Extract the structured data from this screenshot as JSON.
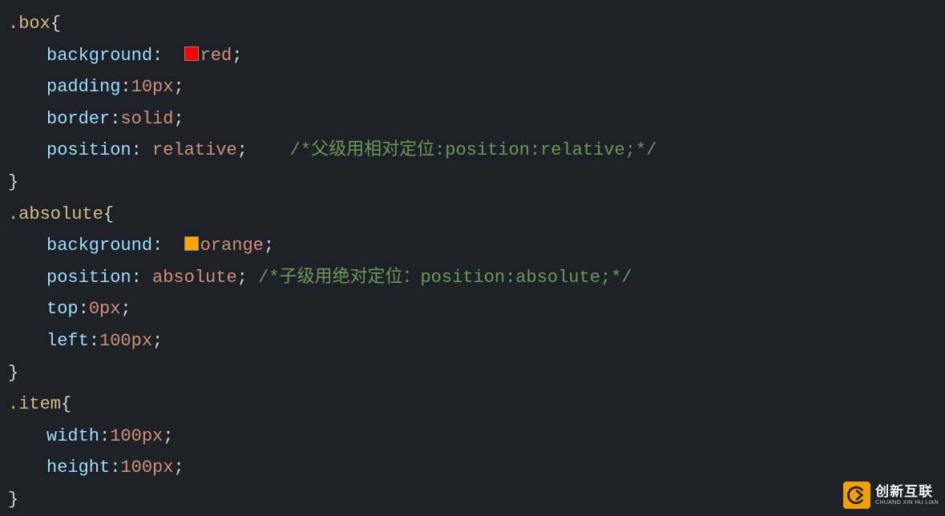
{
  "code": {
    "rule1": {
      "selector": ".box",
      "open_brace": "{",
      "close_brace": "}",
      "props": {
        "p1_name": "background",
        "p1_value": "red",
        "p1_swatch_color": "red",
        "p2_name": "padding",
        "p2_value": "10px",
        "p3_name": "border",
        "p3_value": "solid",
        "p4_name": "position",
        "p4_value": "relative",
        "p4_comment": "/*父级用相对定位:position:relative;*/"
      }
    },
    "rule2": {
      "selector": ".absolute",
      "open_brace": "{",
      "close_brace": "}",
      "props": {
        "p1_name": "background",
        "p1_value": "orange",
        "p1_swatch_color": "orange",
        "p2_name": "position",
        "p2_value": "absolute",
        "p2_comment": "/*子级用绝对定位：position:absolute;*/",
        "p3_name": "top",
        "p3_value": "0px",
        "p4_name": "left",
        "p4_value": "100px"
      }
    },
    "rule3": {
      "selector": ".item",
      "open_brace": "{",
      "close_brace": "}",
      "props": {
        "p1_name": "width",
        "p1_value": "100px",
        "p2_name": "height",
        "p2_value": "100px"
      }
    }
  },
  "punctuation": {
    "colon": ":",
    "colon_sp": ": ",
    "semi": ";"
  },
  "watermark": {
    "title": "创新互联",
    "sub": "CHUANG XIN HU LIAN"
  }
}
